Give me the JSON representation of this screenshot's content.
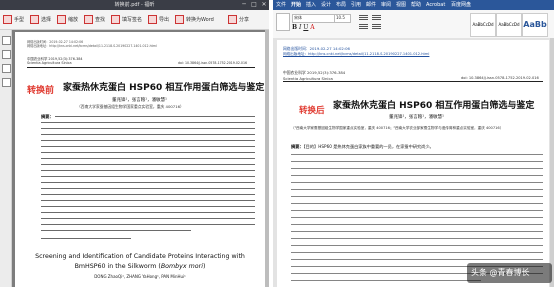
{
  "pdf_viewer": {
    "window_title": "转换前.pdf - 福昕",
    "toolbar": {
      "hand": "手型",
      "select": "选择",
      "zoom": "缩放",
      "find": "查找",
      "sign": "填写签名",
      "export": "导出",
      "convert": "转换为Word",
      "share": "分享"
    }
  },
  "word_app": {
    "tabs": [
      "文件",
      "开始",
      "插入",
      "设计",
      "布局",
      "引用",
      "邮件",
      "审阅",
      "视图",
      "帮助",
      "Acrobat",
      "百度网盘"
    ],
    "font_name": "宋体",
    "font_size": "10.5",
    "styles": [
      "AaBbCcDd",
      "AaBbCcDd",
      "AaBb"
    ]
  },
  "pdf_doc": {
    "meta_line1": "网络出版时间：2019-02-27 14:02:06",
    "meta_line2": "网络出版地址：http://kns.cnki.net/kcms/detail/11.2118.S.20190227.1401.012.html",
    "journal_line": "中国农业科学  2019,52(3):376-384",
    "journal_en": "Scientia Agricultura Sinica",
    "doi": "doi: 10.3864/j.issn.0578-1752.2019.02.016",
    "tag": "转换前",
    "title_cn": "家蚕热休克蛋白 HSP60 相互作用蛋白筛选与鉴定",
    "authors_cn": "董兆锋¹，张言粮¹，潘敏慧¹",
    "affiliation_cn": "（西南大学家蚕基因组生物学国家重点实验室，重庆 400716）",
    "abstract_label": "摘要：",
    "title_en_line1": "Screening and Identification of Candidate Proteins Interacting with",
    "title_en_line2_plain": "BmHSP60 in the Silkworm (",
    "title_en_line2_italic": "Bombyx mori",
    "title_en_line2_end": ")",
    "authors_en": "DONG ZhaoQi¹, ZHANG YaHong¹, PAN MinHui¹"
  },
  "word_doc": {
    "meta_line1": "网络出版时间：2019-02-27 14:02:06",
    "meta_line2": "网络出版地址：http://kns.cnki.net/kcms/detail/11.2118.S.20190227.1401.012.html",
    "journal_line": "中国农业科学  2019,52(3):376-384",
    "journal_en": "Scientia Agricultura Sinica",
    "doi": "doi: 10.3864/j.issn.0578-1752.2019.02.016",
    "tag": "转换后",
    "title_cn": "家蚕热休克蛋白 HSP60 相互作用蛋白筛选与鉴定",
    "authors_cn": "董兆锋¹，张言粮¹，潘敏慧¹",
    "affiliation_cn": "（¹西南大学家蚕基因组生物学国家重点实验室，重庆 400716；²西南大学农业部家蚕生物学与遗传育种重点实验室，重庆 400716）",
    "abstract_label": "摘要：",
    "abstract_start": "【目的】HSP60 是热休克蛋白家族中重要的一员，在家蚕中研究尚少。"
  },
  "watermark": {
    "label": "头条 @青春博长"
  }
}
